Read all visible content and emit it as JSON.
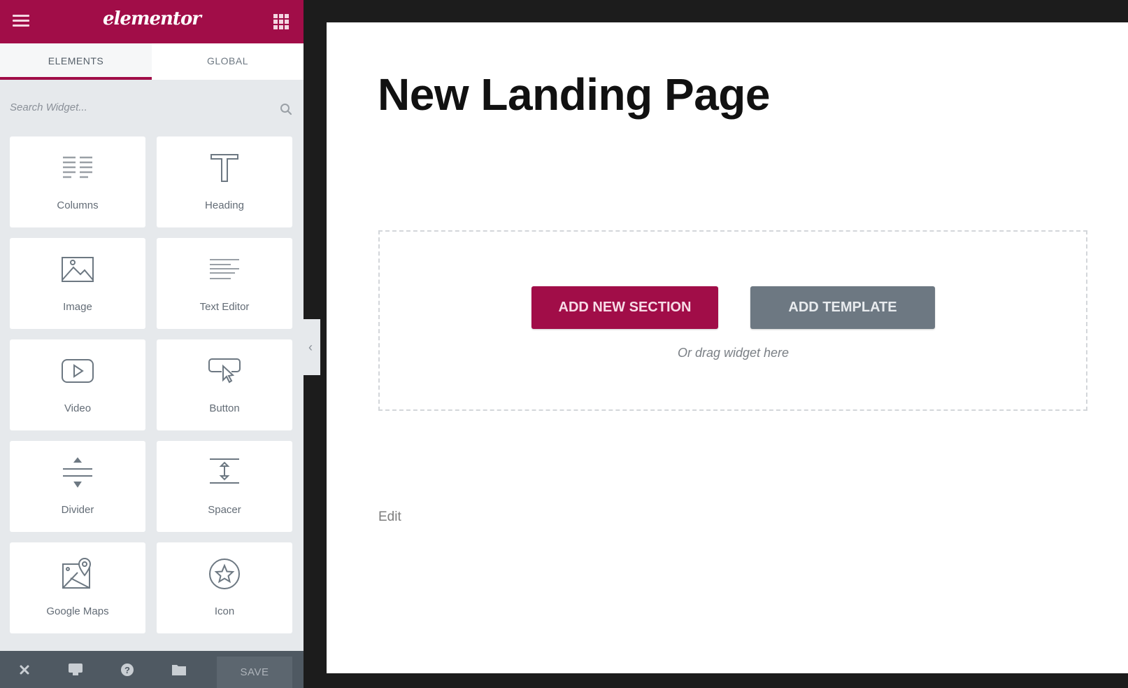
{
  "panel": {
    "logo": "elementor",
    "menu_icon": "hamburger-icon",
    "apps_icon": "grid-icon",
    "tabs": [
      {
        "label": "ELEMENTS",
        "active": true
      },
      {
        "label": "GLOBAL",
        "active": false
      }
    ],
    "search": {
      "placeholder": "Search Widget..."
    },
    "widgets": [
      {
        "label": "Columns",
        "icon": "columns-icon"
      },
      {
        "label": "Heading",
        "icon": "heading-icon"
      },
      {
        "label": "Image",
        "icon": "image-icon"
      },
      {
        "label": "Text Editor",
        "icon": "text-editor-icon"
      },
      {
        "label": "Video",
        "icon": "video-icon"
      },
      {
        "label": "Button",
        "icon": "button-icon"
      },
      {
        "label": "Divider",
        "icon": "divider-icon"
      },
      {
        "label": "Spacer",
        "icon": "spacer-icon"
      },
      {
        "label": "Google Maps",
        "icon": "google-maps-icon"
      },
      {
        "label": "Icon",
        "icon": "star-icon"
      }
    ],
    "footer": {
      "save_label": "SAVE",
      "icons": [
        "close-icon",
        "responsive-icon",
        "help-icon",
        "folder-icon"
      ]
    }
  },
  "canvas": {
    "page_title": "New Landing Page",
    "add_section_label": "ADD NEW SECTION",
    "add_template_label": "ADD TEMPLATE",
    "drag_hint": "Or drag widget here",
    "edit_label": "Edit"
  },
  "colors": {
    "brand": "#a10d48",
    "secondary_button": "#6d7882",
    "panel_bg": "#e6e9ec",
    "footer_bg": "#4f5962",
    "frame": "#1c1c1c"
  }
}
